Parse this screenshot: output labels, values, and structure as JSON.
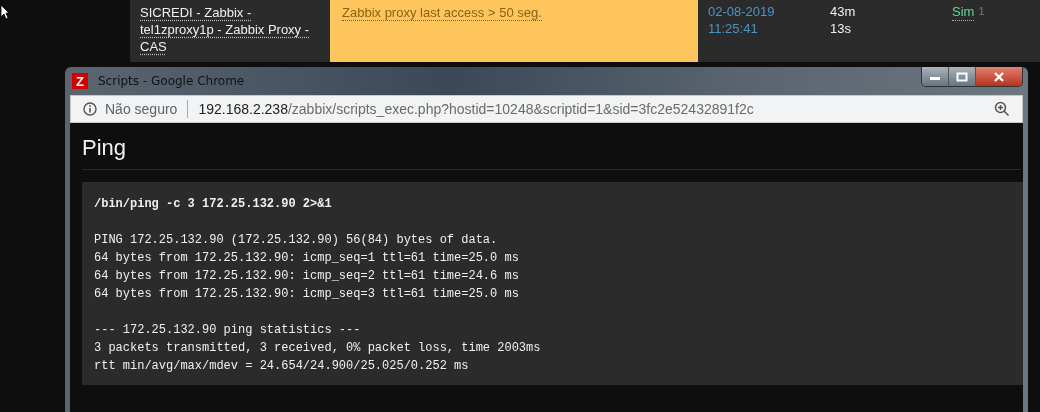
{
  "background_row": {
    "host": "SICREDI - Zabbix - tel1zproxy1p - Zabbix Proxy - CAS",
    "problem": "Zabbix proxy last access > 50 seg.",
    "time": [
      "02-08-2019",
      "11:25:41"
    ],
    "duration": [
      "43m",
      "13s"
    ],
    "ack": "Sim",
    "ack_count": "1"
  },
  "window": {
    "title": "Scripts - Google Chrome",
    "icon_letter": "Z",
    "security": "Não seguro",
    "url": {
      "host": "192.168.2.238",
      "path": "/zabbix/scripts_exec.php?hostid=10248&scriptid=1&sid=3fc2e52432891f2c"
    }
  },
  "page": {
    "heading": "Ping",
    "command": "/bin/ping -c 3 172.25.132.90 2>&1",
    "output": [
      [
        "PING 172.25.132.90 (172.25.132.90) 56(84) bytes of data.",
        "64 bytes from 172.25.132.90: icmp_seq=1 ttl=61 time=25.0 ms",
        "64 bytes from 172.25.132.90: icmp_seq=2 ttl=61 time=24.6 ms",
        "64 bytes from 172.25.132.90: icmp_seq=3 ttl=61 time=25.0 ms"
      ],
      [
        "--- 172.25.132.90 ping statistics ---",
        "3 packets transmitted, 3 received, 0% packet loss, time 2003ms",
        "rtt min/avg/max/mdev = 24.654/24.900/25.025/0.252 ms"
      ]
    ]
  }
}
